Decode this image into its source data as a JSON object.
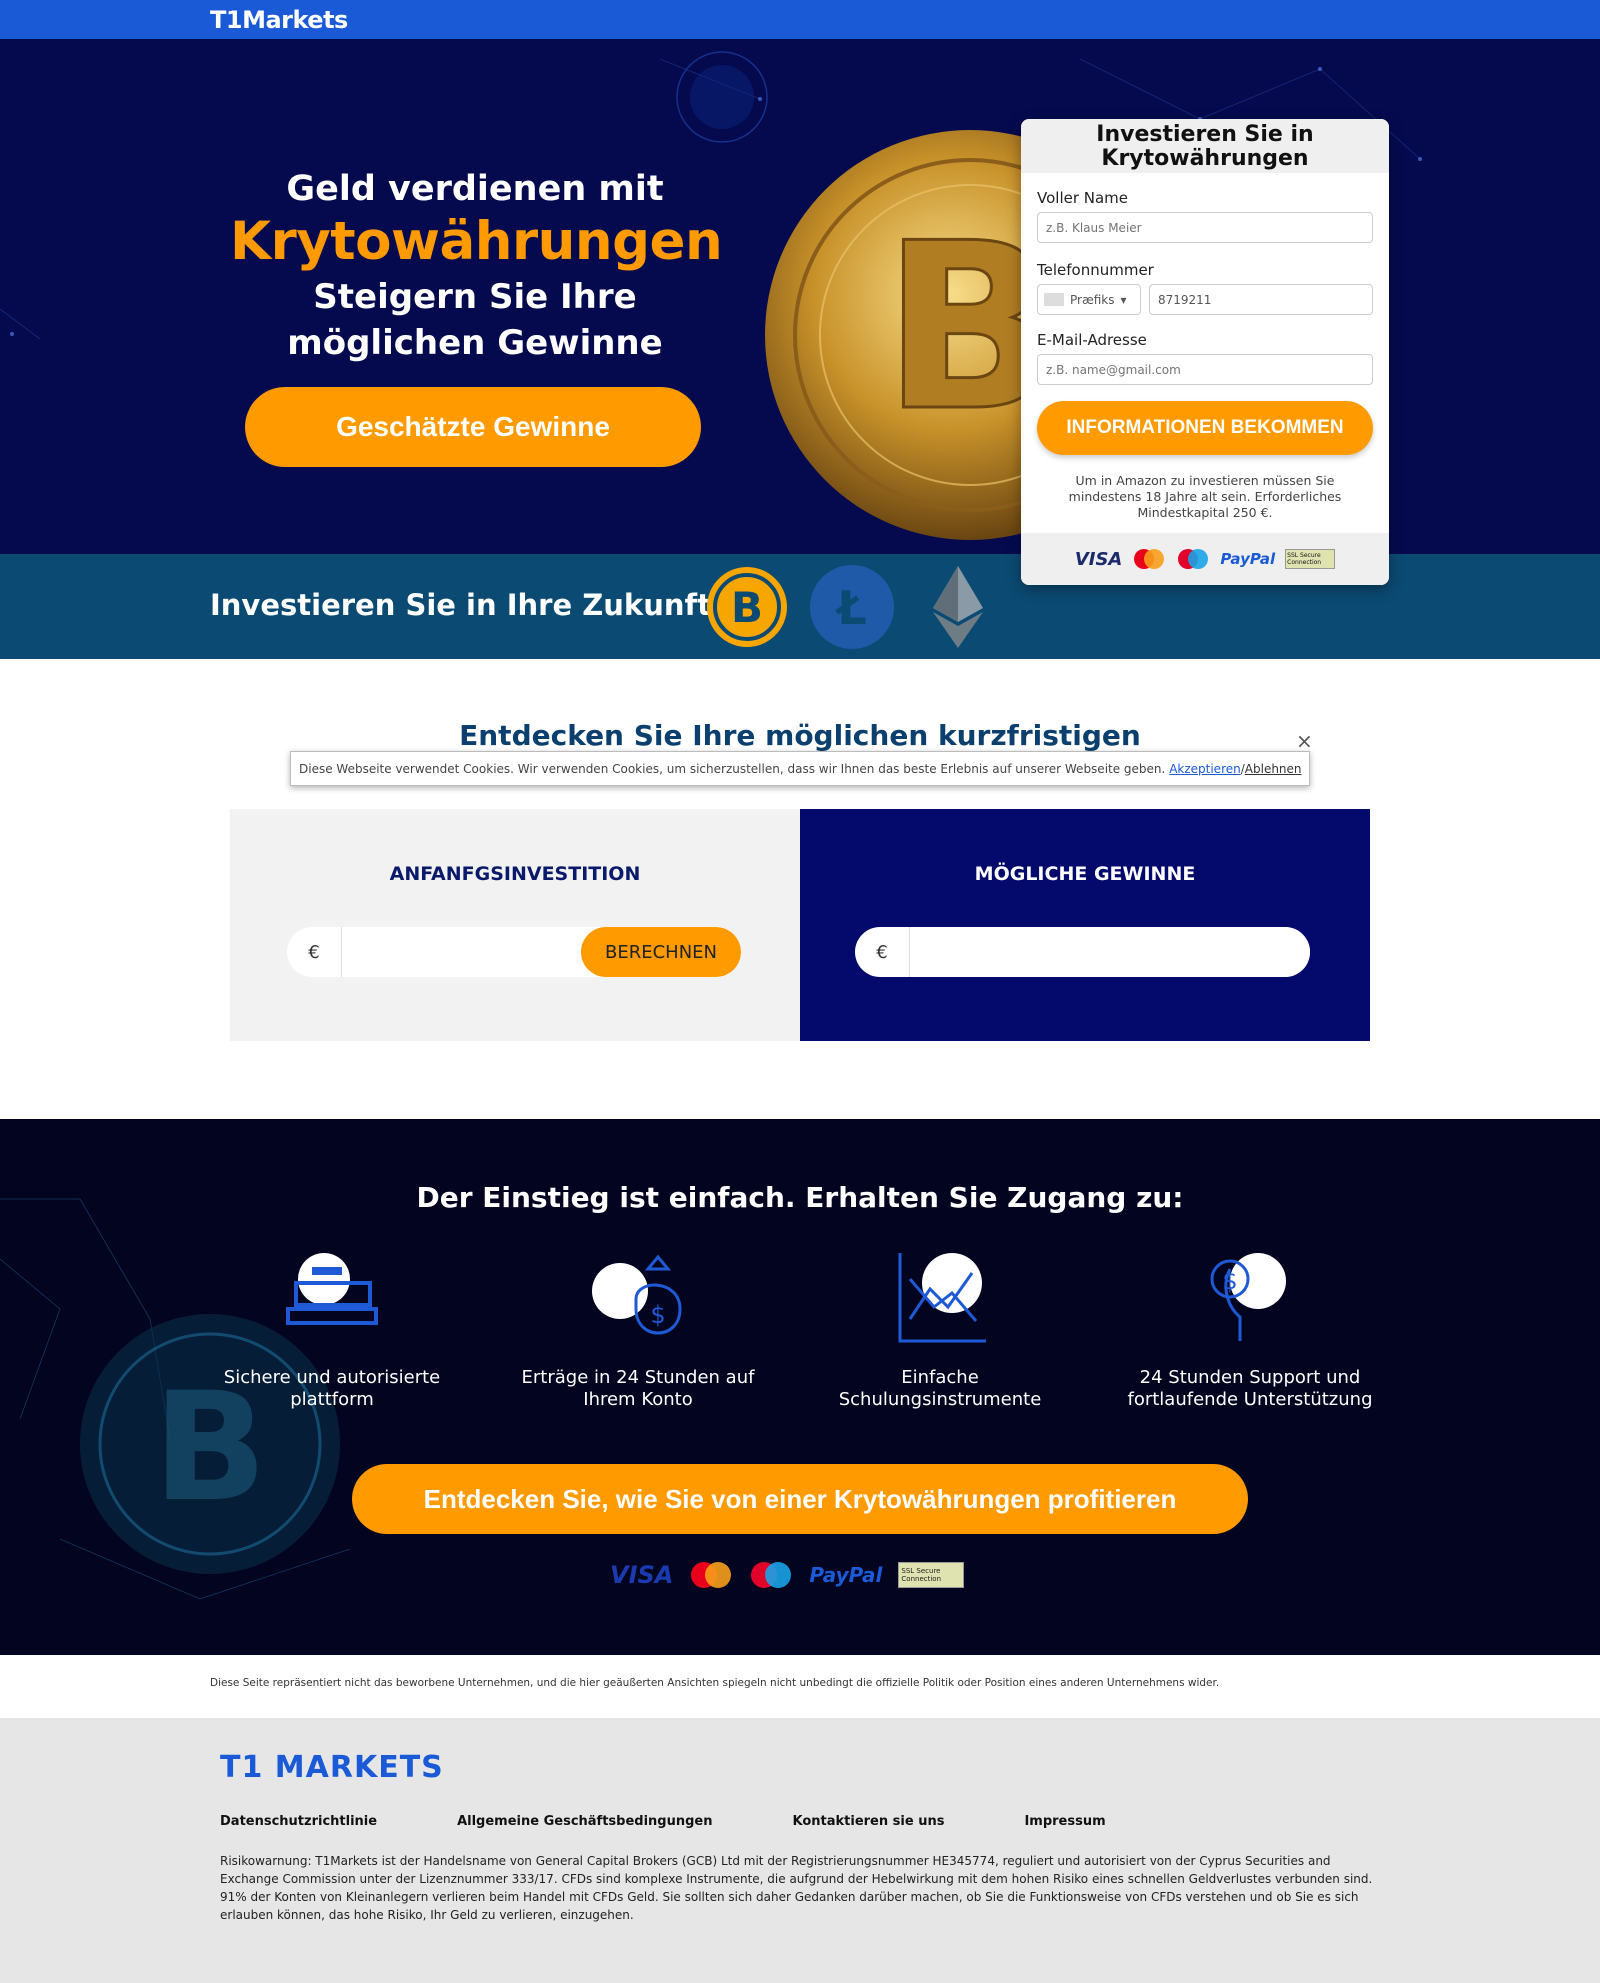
{
  "brand": {
    "top_logo": "T1Markets",
    "footer_logo": "T1 MARKETS"
  },
  "hero": {
    "line1": "Geld verdienen mit",
    "line2": "Krytowährungen",
    "line3a": "Steigern Sie Ihre",
    "line3b": "möglichen Gewinne",
    "cta": "Geschätzte Gewinne"
  },
  "form": {
    "title_line1": "Investieren Sie in",
    "title_line2": "Krytowährungen",
    "name_label": "Voller Name",
    "name_placeholder": "z.B. Klaus Meier",
    "phone_label": "Telefonnummer",
    "prefix_label": "Præfiks",
    "phone_value": "8719211",
    "email_label": "E-Mail-Adresse",
    "email_placeholder": "z.B. name@gmail.com",
    "submit": "INFORMATIONEN BEKOMMEN",
    "note": "Um in Amazon zu investieren müssen Sie mindestens 18 Jahre alt sein. Erforderliches Mindestkapital 250 €."
  },
  "payments": {
    "visa": "VISA",
    "paypal": "PayPal",
    "ssl": "SSL Secure Connection",
    "mastercard": "mastercard",
    "maestro": "maestro"
  },
  "band": {
    "text": "Investieren Sie in Ihre Zukunft"
  },
  "calc": {
    "title": "Entdecken Sie Ihre möglichen kurzfristigen",
    "left_heading": "ANFANFGSINVESTITION",
    "right_heading": "MÖGLICHE GEWINNE",
    "currency": "€",
    "calc_button": "BERECHNEN"
  },
  "cookie": {
    "text": "Diese Webseite verwendet Cookies. Wir verwenden Cookies, um sicherzustellen, dass wir Ihnen das beste Erlebnis auf unserer Webseite geben.",
    "accept": "Akzeptieren",
    "sep": " / ",
    "decline": "Ablehnen",
    "close": "×"
  },
  "features": {
    "title": "Der Einstieg ist einfach. Erhalten Sie Zugang zu:",
    "items": [
      {
        "line1": "Sichere und autorisierte",
        "line2": "plattform"
      },
      {
        "line1": "Erträge in 24 Stunden auf",
        "line2": "Ihrem Konto"
      },
      {
        "line1": "Einfache",
        "line2": "Schulungsinstrumente"
      },
      {
        "line1": "24 Stunden Support und",
        "line2": "fortlaufende Unterstützung"
      }
    ],
    "cta": "Entdecken Sie, wie Sie von einer Krytowährungen profitieren"
  },
  "disclaimer": "Diese Seite repräsentiert nicht das beworbene Unternehmen, und die hier geäußerten Ansichten spiegeln nicht unbedingt die offizielle Politik oder Position eines anderen Unternehmens wider.",
  "footer": {
    "links": [
      "Datenschutzrichtlinie",
      "Allgemeine Geschäftsbedingungen",
      "Kontaktieren sie uns",
      "Impressum"
    ],
    "risk": "Risikowarnung: T1Markets ist der Handelsname von General Capital Brokers (GCB) Ltd mit der Registrierungsnummer HE345774, reguliert und autorisiert von der Cyprus Securities and Exchange Commission unter der Lizenznummer 333/17. CFDs sind komplexe Instrumente, die aufgrund der Hebelwirkung mit dem hohen Risiko eines schnellen Geldverlustes verbunden sind. 91% der Konten von Kleinanlegern verlieren beim Handel mit CFDs Geld. Sie sollten sich daher Gedanken darüber machen, ob Sie die Funktionsweise von CFDs verstehen und ob Sie es sich erlauben können, das hohe Risiko, Ihr Geld zu verlieren, einzugehen."
  },
  "colors": {
    "topbar": "#1a5ad6",
    "hero_bg": "#050a4f",
    "accent_orange": "#ff9a00",
    "band": "#0b4a72",
    "calc_right": "#030a6b",
    "features_bg": "#03041f",
    "footer_bg": "#e6e6e6"
  },
  "icons": [
    "bitcoin-coin-icon",
    "litecoin-icon",
    "ethereum-icon",
    "platform-icon",
    "money-bag-icon",
    "chart-icon",
    "support-icon",
    "close-icon"
  ]
}
